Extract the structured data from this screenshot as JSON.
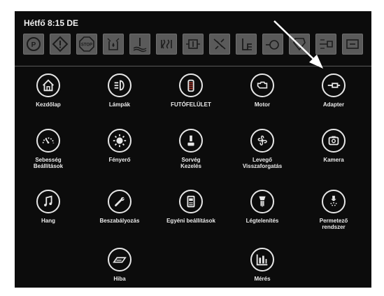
{
  "status": {
    "datetime": "Hétfő 8:15 DE"
  },
  "warning_icons": [
    "parking-brake-icon",
    "general-warning-icon",
    "stop-icon",
    "hydraulic-oil-icon",
    "coolant-level-icon",
    "engine-preheat-icon",
    "charging-system-icon",
    "air-filter-icon",
    "fuel-level-icon",
    "transmission-oil-icon",
    "filter-restriction-icon",
    "adapter-warning-icon",
    "auxiliary-icon"
  ],
  "menu": {
    "items": [
      {
        "label": "Kezdőlap",
        "icon": "home-icon"
      },
      {
        "label": "Lámpák",
        "icon": "lamp-icon"
      },
      {
        "label": "FUTÓFELÜLET",
        "icon": "running-surface-icon"
      },
      {
        "label": "Motor",
        "icon": "engine-icon"
      },
      {
        "label": "Adapter",
        "icon": "adapter-icon"
      },
      {
        "label": "Sebesség\nBeállítások",
        "icon": "speedometer-icon"
      },
      {
        "label": "Fényerő",
        "icon": "brightness-icon"
      },
      {
        "label": "Sorvég\nKezelés",
        "icon": "joystick-icon"
      },
      {
        "label": "Levegő\nVisszaforgatás",
        "icon": "fan-icon"
      },
      {
        "label": "Kamera",
        "icon": "camera-icon"
      },
      {
        "label": "Hang",
        "icon": "music-note-icon"
      },
      {
        "label": "Beszabályozás",
        "icon": "wrench-icon"
      },
      {
        "label": "Egyéni beállítások",
        "icon": "custom-settings-icon"
      },
      {
        "label": "Légtelenítés",
        "icon": "bleed-icon"
      },
      {
        "label": "Permetező\nrendszer",
        "icon": "sprayer-icon"
      },
      {
        "label": "Hiba",
        "icon": "book-icon"
      },
      {
        "label": "Mérés",
        "icon": "bar-chart-icon"
      }
    ]
  }
}
